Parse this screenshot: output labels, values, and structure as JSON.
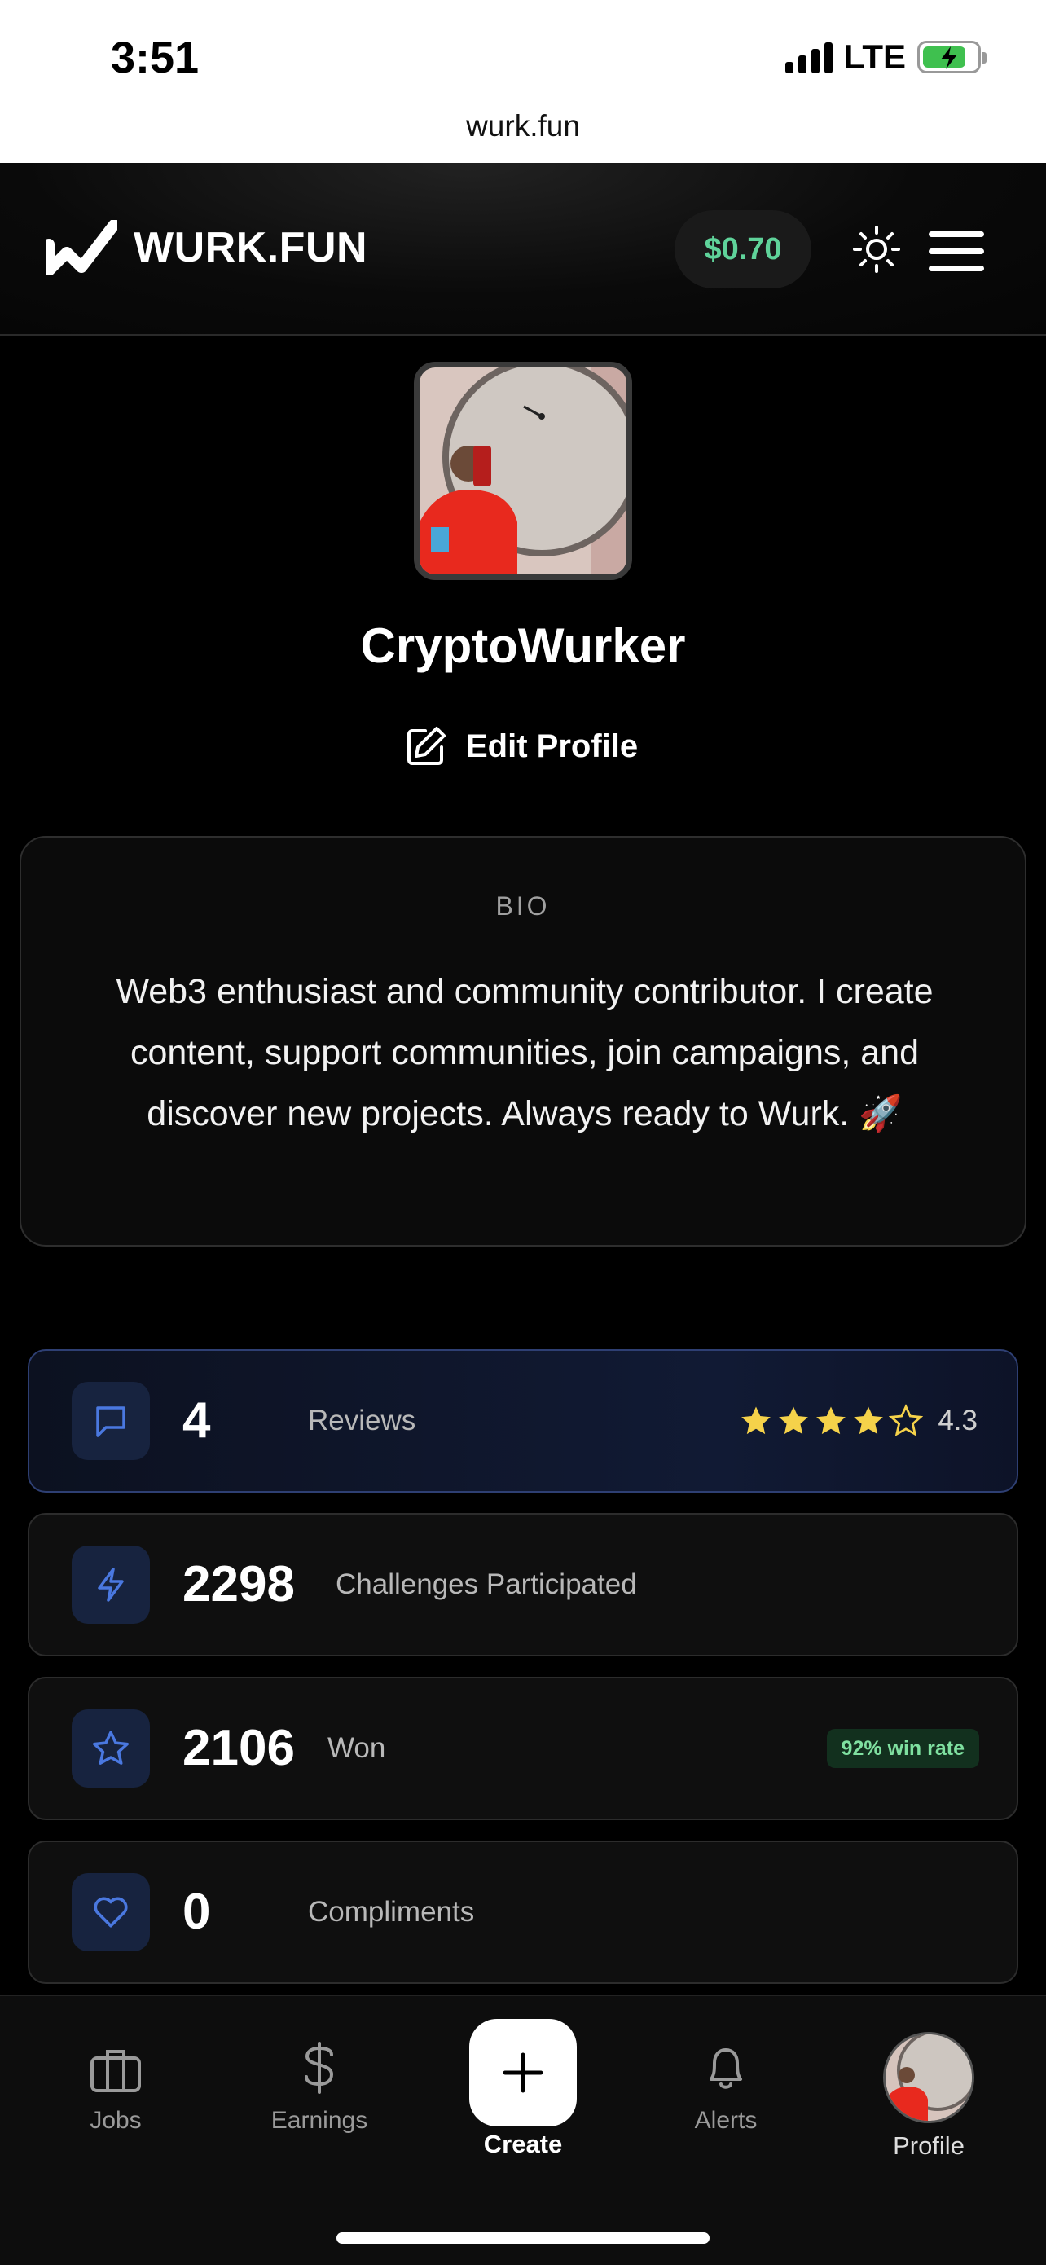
{
  "status_bar": {
    "time": "3:51",
    "network": "LTE"
  },
  "browser": {
    "url": "wurk.fun"
  },
  "header": {
    "logo_text": "WURK.FUN",
    "balance": "$0.70"
  },
  "profile": {
    "username": "CryptoWurker",
    "edit_label": "Edit Profile",
    "bio_label": "BIO",
    "bio_text": "Web3 enthusiast and community contributor. I create content, support communities, join campaigns, and discover new projects. Always ready to Wurk. 🚀"
  },
  "stats": [
    {
      "value": "4",
      "label": "Reviews",
      "rating": "4.3",
      "rating_stars": 4.3,
      "icon": "message-icon"
    },
    {
      "value": "2298",
      "label": "Challenges Participated",
      "icon": "lightning-icon"
    },
    {
      "value": "2106",
      "label": "Won",
      "badge": "92% win rate",
      "icon": "star-icon"
    },
    {
      "value": "0",
      "label": "Compliments",
      "icon": "heart-icon"
    }
  ],
  "tabbar": {
    "jobs": "Jobs",
    "earnings": "Earnings",
    "create": "Create",
    "alerts": "Alerts",
    "profile": "Profile"
  },
  "colors": {
    "accent_green": "#5fd39a",
    "icon_blue": "#4a78e0",
    "star_gold": "#f5d24a"
  }
}
